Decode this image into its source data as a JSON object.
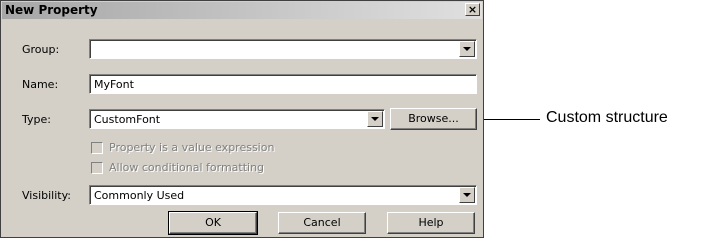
{
  "dialog": {
    "title": "New Property",
    "close_glyph": "×",
    "group": {
      "label": "Group:",
      "value": ""
    },
    "name": {
      "label": "Name:",
      "value": "MyFont"
    },
    "type": {
      "label": "Type:",
      "value": "CustomFont",
      "browse_label": "Browse..."
    },
    "checkboxes": [
      {
        "label": "Property is a value expression",
        "checked": false,
        "enabled": false
      },
      {
        "label": "Allow conditional formatting",
        "checked": false,
        "enabled": false
      }
    ],
    "visibility": {
      "label": "Visibility:",
      "value": "Commonly Used"
    },
    "buttons": {
      "ok": "OK",
      "cancel": "Cancel",
      "help": "Help"
    }
  },
  "callout": {
    "text": "Custom structure"
  }
}
